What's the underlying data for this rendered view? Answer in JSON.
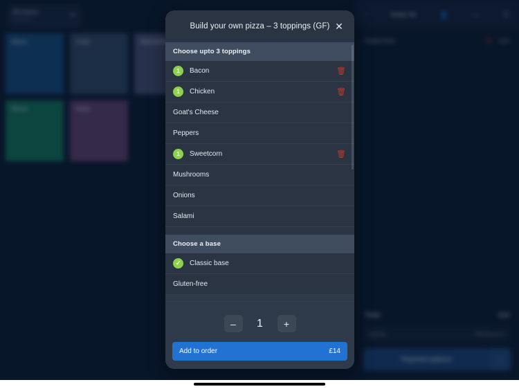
{
  "background": {
    "category_pill": {
      "title": "All items",
      "subtitle": "126 items",
      "caret_icon": "chevron-down-icon"
    },
    "tiles": [
      {
        "label": "Beers",
        "color": "#18558e"
      },
      {
        "label": "Food",
        "color": "#37506f"
      },
      {
        "label": "Soft drinks",
        "color": "#535a82"
      },
      {
        "label": "Spirits",
        "color": "#0d6c86"
      },
      {
        "label": "Wines",
        "color": "#148566"
      },
      {
        "label": "Other",
        "color": "#70497a"
      }
    ],
    "right_panel": {
      "topbar": {
        "back_icon": "chevron-left-icon",
        "title": "Order 41",
        "people_icon": "people-icon",
        "note_icon": "note-icon",
        "menu_icon": "menu-icon"
      },
      "order_line": {
        "name": "Pulled Pork",
        "delete_icon": "trash-icon",
        "price": "£14"
      },
      "total_label": "Total",
      "total_value": "£14",
      "add_tip_label": "Add tip",
      "add_tip_icon": "tip-icon",
      "add_discount_label": "Add discount",
      "add_discount_icon": "discount-icon",
      "pay_label": "Payment options",
      "pay_chevron_icon": "chevron-right-icon"
    }
  },
  "modal": {
    "title": "Build your own pizza – 3 toppings (GF)",
    "close_icon": "close-icon",
    "sections": [
      {
        "header": "Choose upto 3 toppings",
        "options": [
          {
            "label": "Bacon",
            "selected": true,
            "badge": "1",
            "delete_icon": "trash-icon"
          },
          {
            "label": "Chicken",
            "selected": true,
            "badge": "1",
            "delete_icon": "trash-icon"
          },
          {
            "label": "Goat's Cheese",
            "selected": false,
            "badge": "",
            "delete_icon": ""
          },
          {
            "label": "Peppers",
            "selected": false,
            "badge": "",
            "delete_icon": ""
          },
          {
            "label": "Sweetcorn",
            "selected": true,
            "badge": "1",
            "delete_icon": "trash-icon"
          },
          {
            "label": "Mushrooms",
            "selected": false,
            "badge": "",
            "delete_icon": ""
          },
          {
            "label": "Onions",
            "selected": false,
            "badge": "",
            "delete_icon": ""
          },
          {
            "label": "Salami",
            "selected": false,
            "badge": "",
            "delete_icon": ""
          }
        ]
      },
      {
        "header": "Choose a base",
        "options": [
          {
            "label": "Classic base",
            "selected": true,
            "badge": "✓",
            "delete_icon": ""
          },
          {
            "label": "Gluten-free",
            "selected": false,
            "badge": "",
            "delete_icon": ""
          }
        ]
      }
    ],
    "stepper": {
      "decrement_label": "–",
      "decrement_icon": "minus-icon",
      "quantity": "1",
      "increment_label": "+",
      "increment_icon": "plus-icon"
    },
    "add_button": {
      "label": "Add to order",
      "price": "£14"
    }
  },
  "colors": {
    "accent_blue": "#2272d4",
    "selected_green": "#8ed14f",
    "delete_red": "#c0392b",
    "modal_bg": "#2f3a4a",
    "row_bg": "#2a3442",
    "section_header_bg": "#404d60"
  }
}
